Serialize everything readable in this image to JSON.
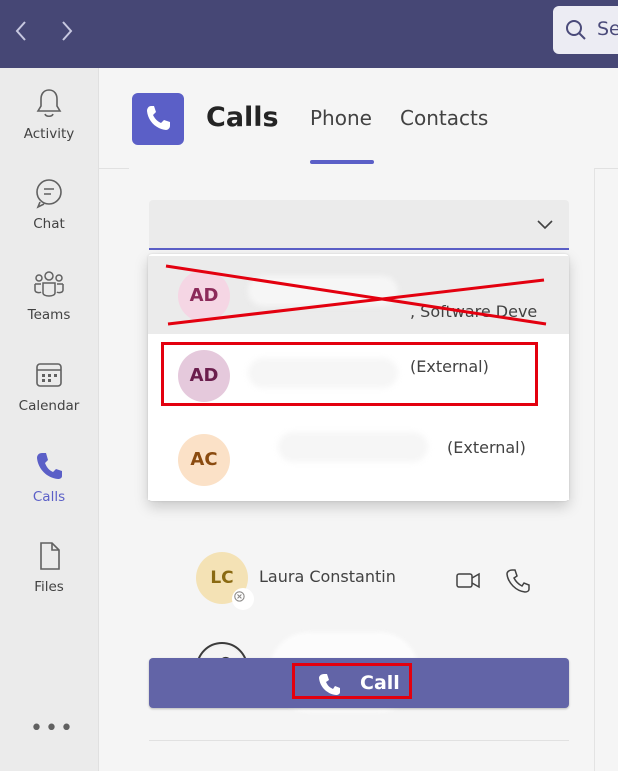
{
  "topbar": {
    "back_icon": "chevron-left-icon",
    "forward_icon": "chevron-right-icon",
    "search_icon": "search-icon",
    "search_placeholder": "Se",
    "color": "#464775"
  },
  "rail": {
    "items": [
      {
        "label": "Activity",
        "icon": "bell-icon"
      },
      {
        "label": "Chat",
        "icon": "chat-icon"
      },
      {
        "label": "Teams",
        "icon": "teams-icon"
      },
      {
        "label": "Calendar",
        "icon": "calendar-icon"
      },
      {
        "label": "Calls",
        "icon": "phone-icon",
        "active": true
      },
      {
        "label": "Files",
        "icon": "file-icon"
      }
    ],
    "more": "•••"
  },
  "header": {
    "title": "Calls",
    "tabs": [
      {
        "label": "Phone",
        "active": true
      },
      {
        "label": "Contacts",
        "active": false
      }
    ],
    "accent": "#5b5fc7"
  },
  "dropdown": {
    "items": [
      {
        "initials": "AD",
        "subtitle": ", Software Deve",
        "crossed_out": true
      },
      {
        "initials": "AD",
        "subtitle": "(External)",
        "highlighted": true
      },
      {
        "initials": "AC",
        "subtitle": "(External)"
      }
    ]
  },
  "contacts": [
    {
      "initials": "LC",
      "name": "Laura Constantin",
      "presence": "offline"
    },
    {
      "initials": "",
      "name": "",
      "presence": "away"
    }
  ],
  "call_button": {
    "label": "Call",
    "color": "#6264a7"
  },
  "annotation_color": "#e3000f"
}
